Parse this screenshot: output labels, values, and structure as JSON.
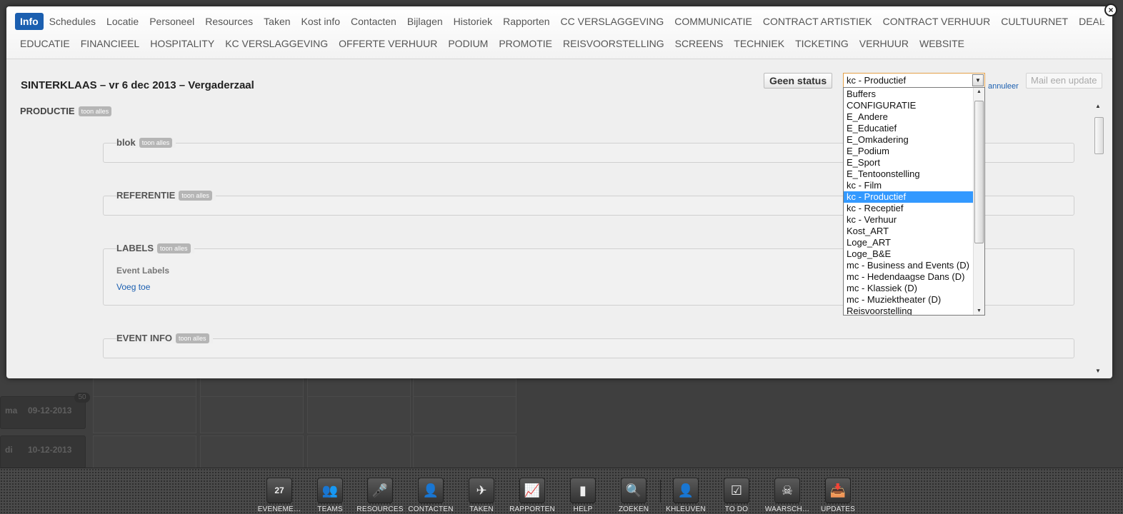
{
  "tabs_row1": [
    "Info",
    "Schedules",
    "Locatie",
    "Personeel",
    "Resources",
    "Taken",
    "Kost info",
    "Contacten",
    "Bijlagen",
    "Historiek",
    "Rapporten",
    "CC VERSLAGGEVING",
    "COMMUNICATIE",
    "CONTRACT ARTISTIEK",
    "CONTRACT VERHUUR",
    "CULTUURNET",
    "DEAL"
  ],
  "tabs_row2": [
    "EDUCATIE",
    "FINANCIEEL",
    "HOSPITALITY",
    "KC VERSLAGGEVING",
    "OFFERTE VERHUUR",
    "PODIUM",
    "PROMOTIE",
    "REISVOORSTELLING",
    "SCREENS",
    "TECHNIEK",
    "TICKETING",
    "VERHUUR",
    "WEBSITE"
  ],
  "active_tab": "Info",
  "header": {
    "title": "SINTERKLAAS – vr 6 dec 2013 – Vergaderzaal",
    "status_button": "Geen status",
    "select_value": "kc - Productief",
    "cancel_link": "annuleer",
    "mail_button": "Mail een update"
  },
  "dropdown_options": [
    "Buffers",
    "CONFIGURATIE",
    "E_Andere",
    "E_Educatief",
    "E_Omkadering",
    "E_Podium",
    "E_Sport",
    "E_Tentoonstelling",
    "kc - Film",
    "kc - Productief",
    "kc - Receptief",
    "kc - Verhuur",
    "Kost_ART",
    "Loge_ART",
    "Loge_B&E",
    "mc - Business and Events (D)",
    "mc - Hedendaagse Dans (D)",
    "mc - Klassiek (D)",
    "mc - Muziektheater (D)",
    "Reisvoorstelling"
  ],
  "dropdown_selected": "kc - Productief",
  "sections": {
    "productie": "PRODUCTIE",
    "show_all": "toon alles",
    "blok": "blok",
    "referentie": "REFERENTIE",
    "labels": "LABELS",
    "event_labels": "Event Labels",
    "add_link": "Voeg toe",
    "event_info": "EVENT INFO"
  },
  "background": {
    "rows": [
      {
        "day": "ma",
        "date": "09-12-2013"
      },
      {
        "day": "di",
        "date": "10-12-2013"
      }
    ],
    "badge": "50"
  },
  "dock": [
    {
      "label": "EVENEME…",
      "icon": "calendar-icon",
      "glyph": "27"
    },
    {
      "label": "TEAMS",
      "icon": "users-icon",
      "glyph": "👥"
    },
    {
      "label": "RESOURCES",
      "icon": "microphone-icon",
      "glyph": "🎤"
    },
    {
      "label": "CONTACTEN",
      "icon": "contact-card-icon",
      "glyph": "👤"
    },
    {
      "label": "TAKEN",
      "icon": "paper-plane-icon",
      "glyph": "✈"
    },
    {
      "label": "RAPPORTEN",
      "icon": "chart-icon",
      "glyph": "📈"
    },
    {
      "label": "HELP",
      "icon": "bookmark-icon",
      "glyph": "▮"
    },
    {
      "label": "ZOEKEN",
      "icon": "search-icon",
      "glyph": "🔍"
    },
    {
      "label": "KHLEUVEN",
      "icon": "user-icon",
      "glyph": "👤"
    },
    {
      "label": "TO DO",
      "icon": "checkbox-icon",
      "glyph": "☑"
    },
    {
      "label": "WAARSCH…",
      "icon": "skull-icon",
      "glyph": "☠"
    },
    {
      "label": "UPDATES",
      "icon": "inbox-download-icon",
      "glyph": "📥"
    }
  ]
}
